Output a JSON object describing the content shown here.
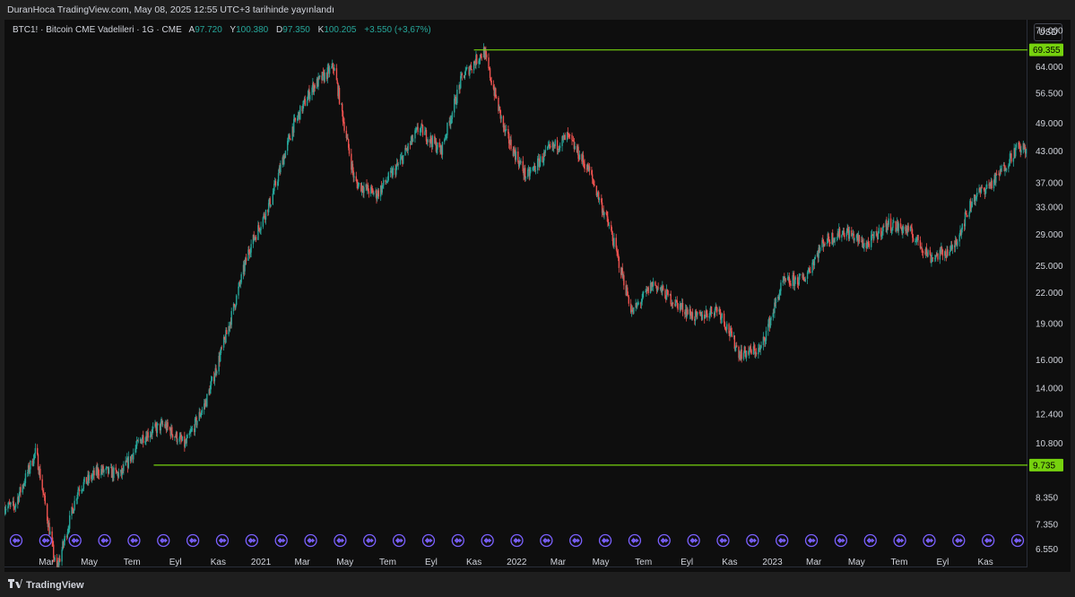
{
  "header": {
    "text": "DuranHoca TradingView.com, May 08, 2025 12:55 UTC+3 tarihinde yayınlandı"
  },
  "legend": {
    "symbol": "BTC1! · Bitcoin CME Vadelileri · 1G · CME",
    "open_label": "A",
    "open": "97.720",
    "high_label": "Y",
    "high": "100.380",
    "low_label": "D",
    "low": "97.350",
    "close_label": "K",
    "close": "100.205",
    "change": "+3.550 (+3,67%)"
  },
  "currency": "USD",
  "footer": {
    "brand": "TradingView",
    "icon": "tradingview-logo-icon"
  },
  "colors": {
    "up": "#26a69a",
    "down": "#ef5350",
    "level": "#76d20e",
    "level_label_bg": "#76d20e",
    "event": "#7b61ff",
    "background": "#0e0e0e"
  },
  "chart_data": {
    "type": "candlestick",
    "scale": "log",
    "ylim": [
      6000,
      80000
    ],
    "y_ticks": [
      "76.000",
      "64.000",
      "56.500",
      "49.000",
      "43.000",
      "37.000",
      "33.000",
      "29.000",
      "25.000",
      "22.000",
      "19.000",
      "16.000",
      "14.000",
      "12.400",
      "10.800",
      "8.350",
      "7.350",
      "6.550"
    ],
    "y_tick_values": [
      76000,
      64000,
      56500,
      49000,
      43000,
      37000,
      33000,
      29000,
      25000,
      22000,
      19000,
      16000,
      14000,
      12400,
      10800,
      8350,
      7350,
      6550
    ],
    "x_ticks": [
      "Mar",
      "May",
      "Tem",
      "Eyl",
      "Kas",
      "2021",
      "Mar",
      "May",
      "Tem",
      "Eyl",
      "Kas",
      "2022",
      "Mar",
      "May",
      "Tem",
      "Eyl",
      "Kas",
      "2023",
      "Mar",
      "May",
      "Tem",
      "Eyl",
      "Kas"
    ],
    "x_tick_months": [
      "2020-03",
      "2020-05",
      "2020-07",
      "2020-09",
      "2020-11",
      "2021-01",
      "2021-03",
      "2021-05",
      "2021-07",
      "2021-09",
      "2021-11",
      "2022-01",
      "2022-03",
      "2022-05",
      "2022-07",
      "2022-09",
      "2022-11",
      "2023-01",
      "2023-03",
      "2023-05",
      "2023-07",
      "2023-09",
      "2023-11"
    ],
    "x_range": [
      "2020-01-01",
      "2023-12-31"
    ],
    "levels": [
      {
        "value": 69355,
        "label": "69.355",
        "from": "2021-11"
      },
      {
        "value": 9735,
        "label": "9.735",
        "from": "2020-08"
      }
    ],
    "event_markers": 35,
    "trend": [
      [
        "2020-01",
        8000
      ],
      [
        "2020-02",
        10400
      ],
      [
        "2020-03",
        5900
      ],
      [
        "2020-04",
        8700
      ],
      [
        "2020-05",
        9500
      ],
      [
        "2020-06",
        9300
      ],
      [
        "2020-07",
        11100
      ],
      [
        "2020-08",
        11800
      ],
      [
        "2020-09",
        10700
      ],
      [
        "2020-10",
        13200
      ],
      [
        "2020-11",
        18500
      ],
      [
        "2020-12",
        27000
      ],
      [
        "2021-01",
        34000
      ],
      [
        "2021-02",
        48000
      ],
      [
        "2021-03",
        58000
      ],
      [
        "2021-04",
        64000
      ],
      [
        "2021-05",
        37000
      ],
      [
        "2021-06",
        35000
      ],
      [
        "2021-07",
        40000
      ],
      [
        "2021-08",
        48000
      ],
      [
        "2021-09",
        43000
      ],
      [
        "2021-10",
        61000
      ],
      [
        "2021-11",
        69000
      ],
      [
        "2021-12",
        47000
      ],
      [
        "2022-01",
        38000
      ],
      [
        "2022-02",
        43000
      ],
      [
        "2022-03",
        46000
      ],
      [
        "2022-04",
        39000
      ],
      [
        "2022-05",
        29500
      ],
      [
        "2022-06",
        20000
      ],
      [
        "2022-07",
        23000
      ],
      [
        "2022-08",
        21000
      ],
      [
        "2022-09",
        19500
      ],
      [
        "2022-10",
        20500
      ],
      [
        "2022-11",
        16500
      ],
      [
        "2022-12",
        16800
      ],
      [
        "2023-01",
        23000
      ],
      [
        "2023-02",
        23500
      ],
      [
        "2023-03",
        28000
      ],
      [
        "2023-04",
        29500
      ],
      [
        "2023-05",
        27500
      ],
      [
        "2023-06",
        30500
      ],
      [
        "2023-07",
        29500
      ],
      [
        "2023-08",
        26000
      ],
      [
        "2023-09",
        27000
      ],
      [
        "2023-10",
        34500
      ],
      [
        "2023-11",
        37500
      ],
      [
        "2023-12",
        43500
      ]
    ]
  }
}
